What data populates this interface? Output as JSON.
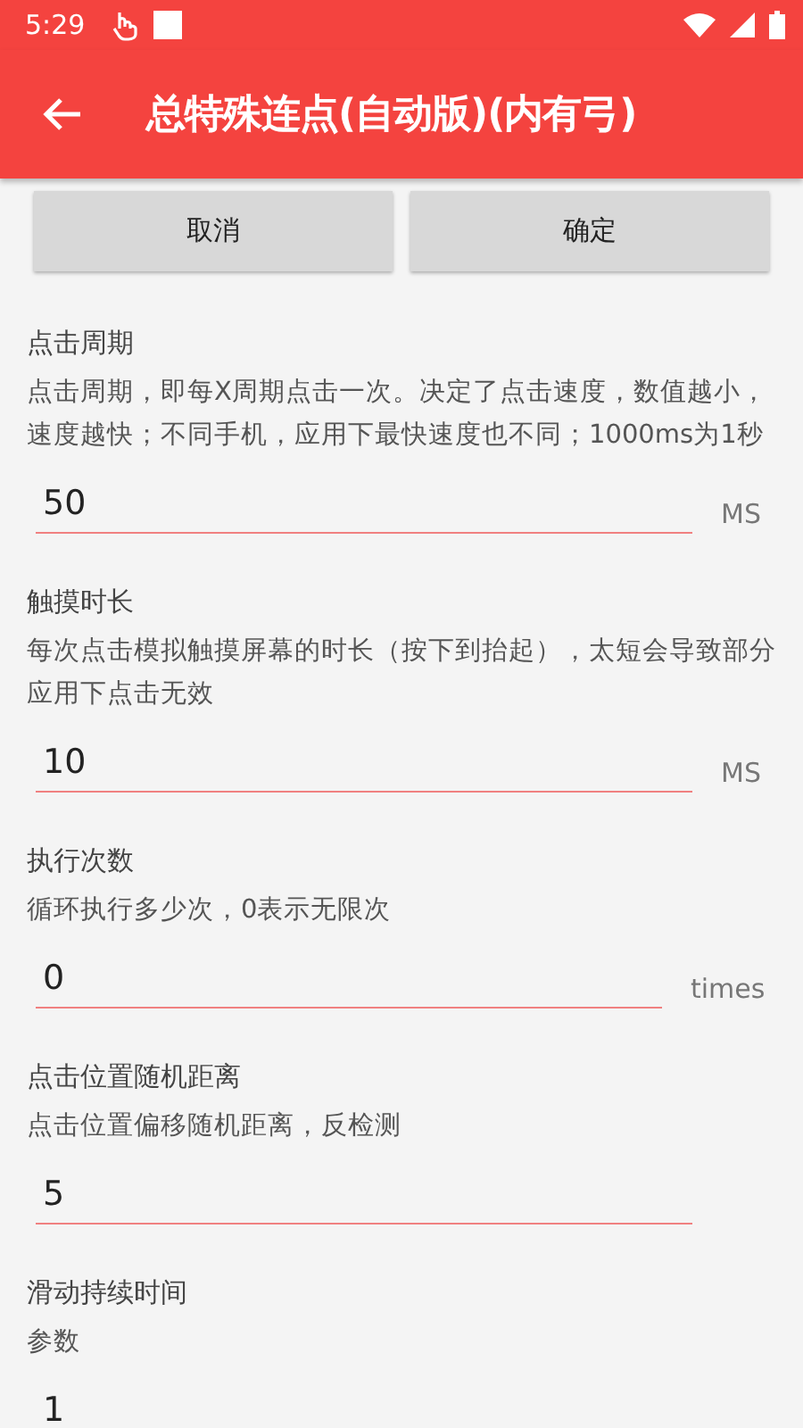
{
  "status_bar": {
    "time": "5:29"
  },
  "app_bar": {
    "title": "总特殊连点(自动版)(内有弓)"
  },
  "buttons": [
    {
      "label": "取消"
    },
    {
      "label": "确定"
    }
  ],
  "settings": [
    {
      "title": "点击周期",
      "description": "点击周期，即每X周期点击一次。决定了点击速度，数值越小，速度越快；不同手机，应用下最快速度也不同；1000ms为1秒",
      "value": "50",
      "unit": "MS"
    },
    {
      "title": "触摸时长",
      "description": "每次点击模拟触摸屏幕的时长（按下到抬起），太短会导致部分应用下点击无效",
      "value": "10",
      "unit": "MS"
    },
    {
      "title": "执行次数",
      "description": "循环执行多少次，0表示无限次",
      "value": "0",
      "unit": "times"
    },
    {
      "title": "点击位置随机距离",
      "description": "点击位置偏移随机距离，反检测",
      "value": "5"
    },
    {
      "title": "滑动持续时间",
      "description": "参数",
      "value": "1"
    }
  ]
}
